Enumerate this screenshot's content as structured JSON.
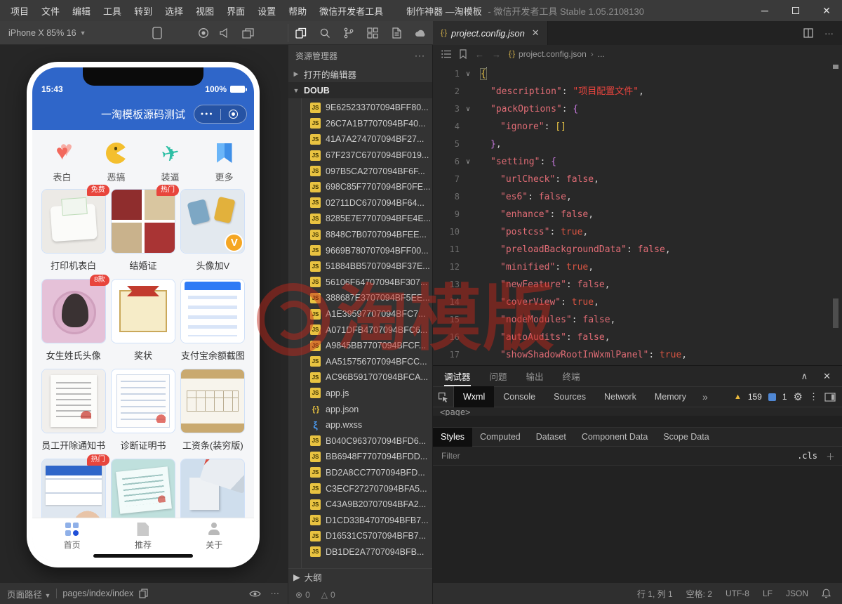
{
  "colors": {
    "accent_blue": "#2f66c9",
    "badge_red": "#e8453c",
    "watermark_red": "#c1271b",
    "file_icon_yellow": "#e9c341",
    "code_key": "#e06c75",
    "code_string": "#e8443e",
    "code_true": "#d65442",
    "code_false": "#e06c75",
    "brace_purple": "#c678dd",
    "bracket_yellow": "#e8c545"
  },
  "titlebar": {
    "menus": [
      "项目",
      "文件",
      "编辑",
      "工具",
      "转到",
      "选择",
      "视图",
      "界面",
      "设置",
      "帮助",
      "微信开发者工具"
    ],
    "title_primary": "制作神器 —淘模板",
    "title_secondary": "- 微信开发者工具 Stable 1.05.2108130"
  },
  "toolbar": {
    "device_label": "iPhone X 85% 16"
  },
  "simulator": {
    "status": {
      "time": "15:43",
      "battery": "100%"
    },
    "nav_title": "一淘模板源码测试",
    "categories": [
      {
        "label": "表白",
        "icon": "heart"
      },
      {
        "label": "恶搞",
        "icon": "pacman"
      },
      {
        "label": "装逼",
        "icon": "plane"
      },
      {
        "label": "更多",
        "icon": "bookmark"
      }
    ],
    "cards": [
      {
        "label": "打印机表白",
        "badge": "免费",
        "art": "printer"
      },
      {
        "label": "结婚证",
        "badge": "热门",
        "art": "marriage"
      },
      {
        "label": "头像加V",
        "vbadge": "V",
        "art": "avatarv"
      },
      {
        "label": "女生姓氏头像",
        "badge": "8款",
        "art": "girl"
      },
      {
        "label": "奖状",
        "art": "award"
      },
      {
        "label": "支付宝余额截图",
        "art": "alipay"
      },
      {
        "label": "员工开除通知书",
        "art": "dismissal"
      },
      {
        "label": "诊断证明书",
        "art": "diagnosis"
      },
      {
        "label": "工资条(装穷版)",
        "art": "payslip"
      },
      {
        "label": "",
        "badge": "热门",
        "art": "boarding"
      },
      {
        "label": "",
        "art": "train"
      },
      {
        "label": "",
        "art": "wing"
      }
    ],
    "tabbar": [
      {
        "label": "首页",
        "icon": "home",
        "active": true
      },
      {
        "label": "推荐",
        "icon": "tag",
        "active": false
      },
      {
        "label": "关于",
        "icon": "person",
        "active": false
      }
    ]
  },
  "explorer": {
    "title": "资源管理器",
    "open_editors_label": "打开的编辑器",
    "root_label": "DOUB",
    "files": [
      {
        "name": "9E625233707094BFF80...",
        "type": "js"
      },
      {
        "name": "26C7A1B7707094BF40...",
        "type": "js"
      },
      {
        "name": "41A7A274707094BF27...",
        "type": "js"
      },
      {
        "name": "67F237C6707094BF019...",
        "type": "js"
      },
      {
        "name": "097B5CA2707094BF6F...",
        "type": "js"
      },
      {
        "name": "698C85F7707094BF0FE...",
        "type": "js"
      },
      {
        "name": "02711DC6707094BF64...",
        "type": "js"
      },
      {
        "name": "8285E7E7707094BFE4E...",
        "type": "js"
      },
      {
        "name": "8848C7B0707094BFEE...",
        "type": "js"
      },
      {
        "name": "9669B780707094BFF00...",
        "type": "js"
      },
      {
        "name": "51884BB5707094BF37E...",
        "type": "js"
      },
      {
        "name": "56106F64707094BF307...",
        "type": "js"
      },
      {
        "name": "388687E3707094BF5EE...",
        "type": "js"
      },
      {
        "name": "A1E39597707094BFC7...",
        "type": "js"
      },
      {
        "name": "A071DFB4707094BFC6...",
        "type": "js"
      },
      {
        "name": "A9845BB7707094BFCF...",
        "type": "js"
      },
      {
        "name": "AA515756707094BFCC...",
        "type": "js"
      },
      {
        "name": "AC96B591707094BFCA...",
        "type": "js"
      },
      {
        "name": "app.js",
        "type": "js"
      },
      {
        "name": "app.json",
        "type": "json"
      },
      {
        "name": "app.wxss",
        "type": "wxss"
      },
      {
        "name": "B040C963707094BFD6...",
        "type": "js"
      },
      {
        "name": "BB6948F7707094BFDD...",
        "type": "js"
      },
      {
        "name": "BD2A8CC7707094BFD...",
        "type": "js"
      },
      {
        "name": "C3ECF272707094BFA5...",
        "type": "js"
      },
      {
        "name": "C43A9B20707094BFA2...",
        "type": "js"
      },
      {
        "name": "D1CD33B4707094BFB7...",
        "type": "js"
      },
      {
        "name": "D16531C5707094BFB7...",
        "type": "js"
      },
      {
        "name": "DB1DE2A7707094BFB...",
        "type": "js"
      }
    ],
    "outline_label": "大纲",
    "problems": {
      "errors": "0",
      "warnings": "0"
    }
  },
  "editor": {
    "tab_label": "project.config.json",
    "breadcrumb_file": "project.config.json",
    "breadcrumb_more": "...",
    "lines": [
      {
        "n": "1",
        "fold": true,
        "ind": 0,
        "cur": true,
        "tok": [
          [
            "by m",
            "{"
          ]
        ]
      },
      {
        "n": "2",
        "fold": false,
        "ind": 1,
        "tok": [
          [
            "key",
            "\"description\""
          ],
          [
            "pu",
            ": "
          ],
          [
            "str",
            "\"项目配置文件\""
          ],
          [
            "pu",
            ","
          ]
        ]
      },
      {
        "n": "3",
        "fold": true,
        "ind": 1,
        "tok": [
          [
            "key",
            "\"packOptions\""
          ],
          [
            "pu",
            ": "
          ],
          [
            "bp",
            "{"
          ]
        ]
      },
      {
        "n": "4",
        "fold": false,
        "ind": 2,
        "tok": [
          [
            "key",
            "\"ignore\""
          ],
          [
            "pu",
            ": "
          ],
          [
            "by",
            "[]"
          ]
        ]
      },
      {
        "n": "5",
        "fold": false,
        "ind": 1,
        "tok": [
          [
            "bp",
            "}"
          ],
          [
            "pu",
            ","
          ]
        ]
      },
      {
        "n": "6",
        "fold": true,
        "ind": 1,
        "tok": [
          [
            "key",
            "\"setting\""
          ],
          [
            "pu",
            ": "
          ],
          [
            "bp",
            "{"
          ]
        ]
      },
      {
        "n": "7",
        "fold": false,
        "ind": 2,
        "tok": [
          [
            "key",
            "\"urlCheck\""
          ],
          [
            "pu",
            ": "
          ],
          [
            "bf",
            "false"
          ],
          [
            "pu",
            ","
          ]
        ]
      },
      {
        "n": "8",
        "fold": false,
        "ind": 2,
        "tok": [
          [
            "key",
            "\"es6\""
          ],
          [
            "pu",
            ": "
          ],
          [
            "bf",
            "false"
          ],
          [
            "pu",
            ","
          ]
        ]
      },
      {
        "n": "9",
        "fold": false,
        "ind": 2,
        "tok": [
          [
            "key",
            "\"enhance\""
          ],
          [
            "pu",
            ": "
          ],
          [
            "bf",
            "false"
          ],
          [
            "pu",
            ","
          ]
        ]
      },
      {
        "n": "10",
        "fold": false,
        "ind": 2,
        "tok": [
          [
            "key",
            "\"postcss\""
          ],
          [
            "pu",
            ": "
          ],
          [
            "bt",
            "true"
          ],
          [
            "pu",
            ","
          ]
        ]
      },
      {
        "n": "11",
        "fold": false,
        "ind": 2,
        "tok": [
          [
            "key",
            "\"preloadBackgroundData\""
          ],
          [
            "pu",
            ": "
          ],
          [
            "bf",
            "false"
          ],
          [
            "pu",
            ","
          ]
        ]
      },
      {
        "n": "12",
        "fold": false,
        "ind": 2,
        "tok": [
          [
            "key",
            "\"minified\""
          ],
          [
            "pu",
            ": "
          ],
          [
            "bt",
            "true"
          ],
          [
            "pu",
            ","
          ]
        ]
      },
      {
        "n": "13",
        "fold": false,
        "ind": 2,
        "tok": [
          [
            "key",
            "\"newFeature\""
          ],
          [
            "pu",
            ": "
          ],
          [
            "bf",
            "false"
          ],
          [
            "pu",
            ","
          ]
        ]
      },
      {
        "n": "14",
        "fold": false,
        "ind": 2,
        "tok": [
          [
            "key",
            "\"coverView\""
          ],
          [
            "pu",
            ": "
          ],
          [
            "bt",
            "true"
          ],
          [
            "pu",
            ","
          ]
        ]
      },
      {
        "n": "15",
        "fold": false,
        "ind": 2,
        "tok": [
          [
            "key",
            "\"nodeModules\""
          ],
          [
            "pu",
            ": "
          ],
          [
            "bf",
            "false"
          ],
          [
            "pu",
            ","
          ]
        ]
      },
      {
        "n": "16",
        "fold": false,
        "ind": 2,
        "tok": [
          [
            "key",
            "\"autoAudits\""
          ],
          [
            "pu",
            ": "
          ],
          [
            "bf",
            "false"
          ],
          [
            "pu",
            ","
          ]
        ]
      },
      {
        "n": "17",
        "fold": false,
        "ind": 2,
        "tok": [
          [
            "key",
            "\"showShadowRootInWxmlPanel\""
          ],
          [
            "pu",
            ": "
          ],
          [
            "bt",
            "true"
          ],
          [
            "pu",
            ","
          ]
        ]
      }
    ]
  },
  "debug": {
    "panel_tabs": [
      {
        "label": "调试器",
        "active": true
      },
      {
        "label": "问题",
        "active": false
      },
      {
        "label": "输出",
        "active": false
      },
      {
        "label": "终端",
        "active": false
      }
    ],
    "devtools_tabs": [
      {
        "label": "Wxml",
        "active": true
      },
      {
        "label": "Console",
        "active": false
      },
      {
        "label": "Sources",
        "active": false
      },
      {
        "label": "Network",
        "active": false
      },
      {
        "label": "Memory",
        "active": false
      }
    ],
    "warning_count": "159",
    "info_count": "1",
    "tree_text": "<page>",
    "style_tabs": [
      {
        "label": "Styles",
        "active": true
      },
      {
        "label": "Computed",
        "active": false
      },
      {
        "label": "Dataset",
        "active": false
      },
      {
        "label": "Component Data",
        "active": false
      },
      {
        "label": "Scope Data",
        "active": false
      }
    ],
    "filter_placeholder": "Filter",
    "cls_label": ".cls"
  },
  "statusbar": {
    "page_path_label": "页面路径",
    "page_path_value": "pages/index/index",
    "right_items": [
      "行 1, 列 1",
      "空格: 2",
      "UTF-8",
      "LF",
      "JSON"
    ]
  },
  "watermark": {
    "text": "淘模版"
  }
}
